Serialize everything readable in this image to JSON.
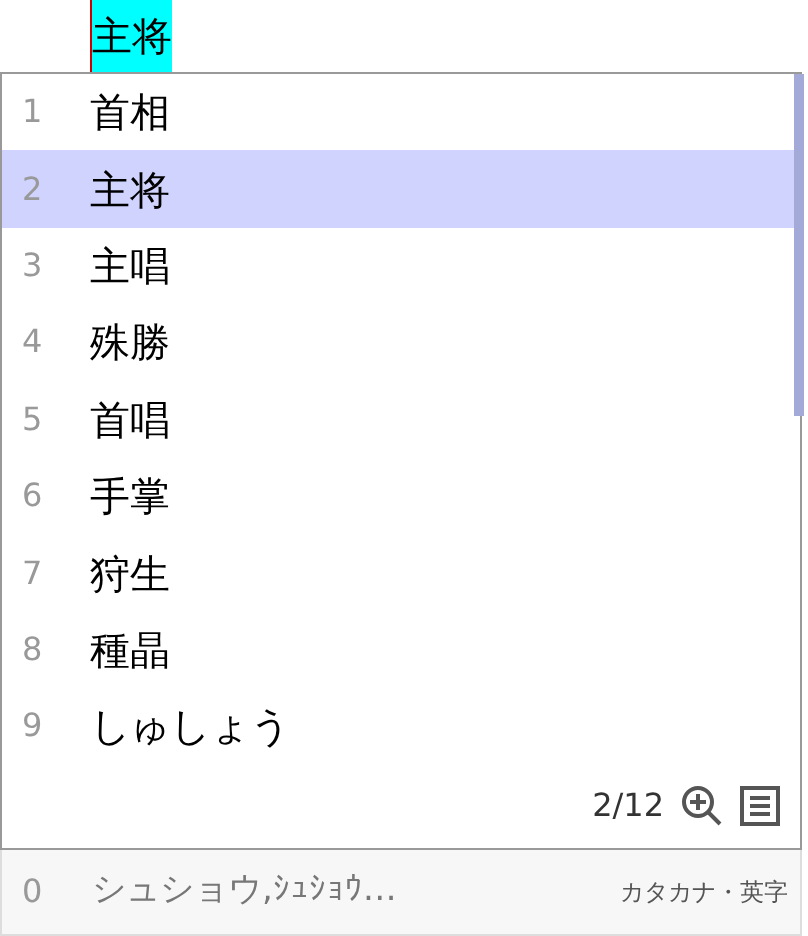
{
  "composition": {
    "text": "主将"
  },
  "candidates": [
    {
      "number": "1",
      "text": "首相",
      "selected": false
    },
    {
      "number": "2",
      "text": "主将",
      "selected": true
    },
    {
      "number": "3",
      "text": "主唱",
      "selected": false
    },
    {
      "number": "4",
      "text": "殊勝",
      "selected": false
    },
    {
      "number": "5",
      "text": "首唱",
      "selected": false
    },
    {
      "number": "6",
      "text": "手掌",
      "selected": false
    },
    {
      "number": "7",
      "text": "狩生",
      "selected": false
    },
    {
      "number": "8",
      "text": "種晶",
      "selected": false
    },
    {
      "number": "9",
      "text": "しゅしょう",
      "selected": false
    }
  ],
  "page_indicator": "2/12",
  "extra_row": {
    "number": "0",
    "text": "シュショウ,ｼｭｼｮｳ…",
    "hint": "カタカナ・英字"
  }
}
